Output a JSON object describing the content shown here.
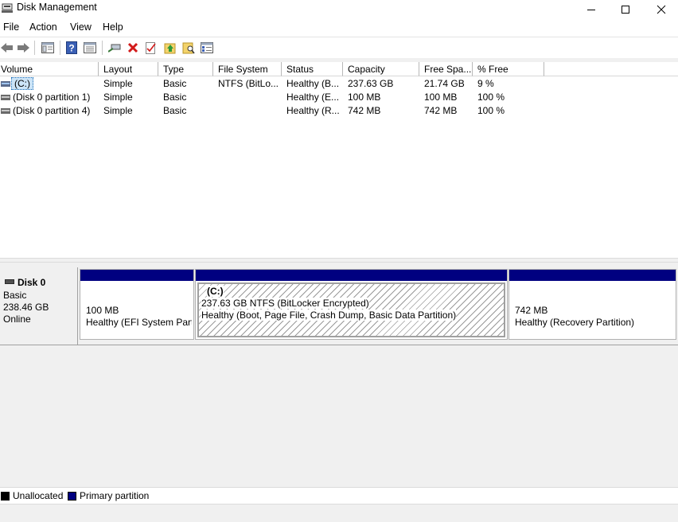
{
  "window": {
    "title": "Disk Management"
  },
  "menu": [
    "File",
    "Action",
    "View",
    "Help"
  ],
  "toolbar": [
    "back-arrow-icon",
    "forward-arrow-icon",
    "console-tree-icon",
    "help-icon",
    "properties-list-icon",
    "connect-disk-icon",
    "delete-icon",
    "check-properties-icon",
    "up-folder-icon",
    "search-folder-icon",
    "settings-list-icon"
  ],
  "columns": [
    "Volume",
    "Layout",
    "Type",
    "File System",
    "Status",
    "Capacity",
    "Free Spa...",
    "% Free"
  ],
  "volumes": [
    {
      "volume": "(C:)",
      "layout": "Simple",
      "type": "Basic",
      "fs": "NTFS (BitLo...",
      "status": "Healthy (B...",
      "capacity": "237.63 GB",
      "free": "21.74 GB",
      "pct": "9 %"
    },
    {
      "volume": "(Disk 0 partition 1)",
      "layout": "Simple",
      "type": "Basic",
      "fs": "",
      "status": "Healthy (E...",
      "capacity": "100 MB",
      "free": "100 MB",
      "pct": "100 %"
    },
    {
      "volume": "(Disk 0 partition 4)",
      "layout": "Simple",
      "type": "Basic",
      "fs": "",
      "status": "Healthy (R...",
      "capacity": "742 MB",
      "free": "742 MB",
      "pct": "100 %"
    }
  ],
  "disk": {
    "name": "Disk 0",
    "kind": "Basic",
    "size": "238.46 GB",
    "state": "Online"
  },
  "partitions": [
    {
      "label": "",
      "size": "100 MB",
      "status": "Healthy (EFI System Parti"
    },
    {
      "label": "(C:)",
      "size": "237.63 GB NTFS (BitLocker Encrypted)",
      "status": "Healthy (Boot, Page File, Crash Dump, Basic Data Partition)"
    },
    {
      "label": "",
      "size": "742 MB",
      "status": "Healthy (Recovery Partition)"
    }
  ],
  "legend": {
    "unallocated": "Unallocated",
    "primary": "Primary partition"
  },
  "colors": {
    "primary": "#000080",
    "unallocated": "#000000",
    "selection": "#cce4f7"
  }
}
